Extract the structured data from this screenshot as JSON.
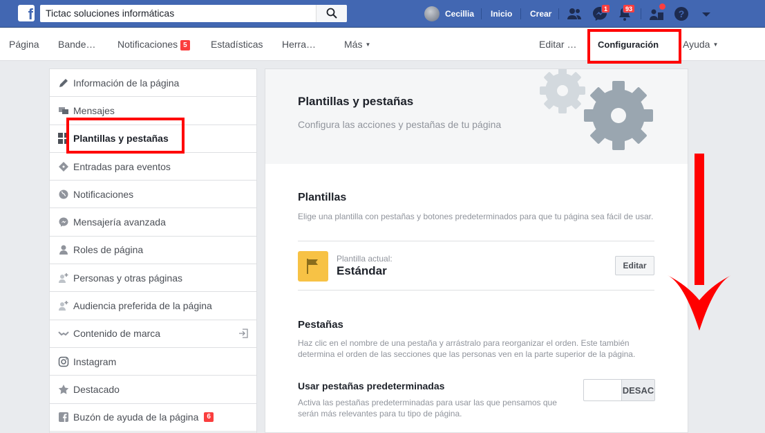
{
  "topbar": {
    "search_value": "Tictac soluciones informáticas",
    "user_name": "Cecillia",
    "home_label": "Inicio",
    "create_label": "Crear",
    "messenger_badge": "1",
    "notifications_badge": "93"
  },
  "pagenav": {
    "items": [
      "Página",
      "Bande…",
      "Notificaciones",
      "Estadísticas",
      "Herra…",
      "Más",
      "Editar …",
      "Configuración",
      "Ayuda"
    ],
    "notifications_badge": "5"
  },
  "sidebar": {
    "items": [
      {
        "label": "Información de la página",
        "icon": "pencil-icon"
      },
      {
        "label": "Mensajes",
        "icon": "chat-bubbles-icon"
      },
      {
        "label": "Plantillas y pestañas",
        "icon": "grid-icon"
      },
      {
        "label": "Entradas para eventos",
        "icon": "ticket-icon"
      },
      {
        "label": "Notificaciones",
        "icon": "globe-icon"
      },
      {
        "label": "Mensajería avanzada",
        "icon": "messenger-icon"
      },
      {
        "label": "Roles de página",
        "icon": "person-icon"
      },
      {
        "label": "Personas y otras páginas",
        "icon": "person-add-icon"
      },
      {
        "label": "Audiencia preferida de la página",
        "icon": "person-add-icon"
      },
      {
        "label": "Contenido de marca",
        "icon": "handshake-icon"
      },
      {
        "label": "Instagram",
        "icon": "instagram-icon"
      },
      {
        "label": "Destacado",
        "icon": "star-icon"
      },
      {
        "label": "Buzón de ayuda de la página",
        "icon": "facebook-icon",
        "badge": "6"
      }
    ]
  },
  "main": {
    "title": "Plantillas y pestañas",
    "subtitle": "Configura las acciones y pestañas de tu página",
    "templates": {
      "title": "Plantillas",
      "description": "Elige una plantilla con pestañas y botones predeterminados para que tu página sea fácil de usar.",
      "current_label": "Plantilla actual:",
      "current_value": "Estándar",
      "edit_button": "Editar"
    },
    "tabs": {
      "title": "Pestañas",
      "description_1": "Haz clic en el nombre de una pestaña y arrástralo para reorganizar el orden. Este también",
      "description_2": "determina el orden de las secciones que las personas ven en la parte superior de la página.",
      "default_tabs_title": "Usar pestañas predeterminadas",
      "default_tabs_desc_1": "Activa las pestañas predeterminadas para usar las que pensamos que",
      "default_tabs_desc_2": "serán más relevantes para tu tipo de página.",
      "toggle_label": "DESAC"
    }
  },
  "colors": {
    "brand_blue": "#4267b2",
    "annotation_red": "#ff0000",
    "template_icon_bg": "#f7c245"
  }
}
